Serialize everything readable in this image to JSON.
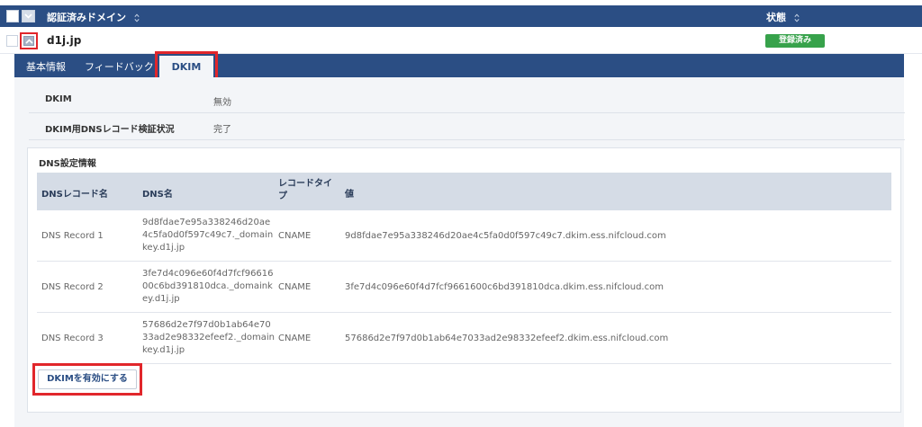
{
  "header": {
    "domain_column": "認証済みドメイン",
    "status_column": "状態"
  },
  "domain_row": {
    "domain": "d1j.jp",
    "status": "登録済み"
  },
  "tabs": [
    {
      "label": "基本情報",
      "active": false
    },
    {
      "label": "フィードバック",
      "active": false
    },
    {
      "label": "DKIM",
      "active": true
    }
  ],
  "dkim_info": [
    {
      "label": "DKIM",
      "value": "無効"
    },
    {
      "label": "DKIM用DNSレコード検証状況",
      "value": "完了"
    }
  ],
  "dns_settings": {
    "title": "DNS設定情報",
    "columns": [
      "DNSレコード名",
      "DNS名",
      "レコードタイプ",
      "値"
    ],
    "rows": [
      {
        "record_name": "DNS Record 1",
        "dns_name": "9d8fdae7e95a338246d20ae4c5fa0d0f597c49c7._domainkey.d1j.jp",
        "type": "CNAME",
        "value": "9d8fdae7e95a338246d20ae4c5fa0d0f597c49c7.dkim.ess.nifcloud.com"
      },
      {
        "record_name": "DNS Record 2",
        "dns_name": "3fe7d4c096e60f4d7fcf9661600c6bd391810dca._domainkey.d1j.jp",
        "type": "CNAME",
        "value": "3fe7d4c096e60f4d7fcf9661600c6bd391810dca.dkim.ess.nifcloud.com"
      },
      {
        "record_name": "DNS Record 3",
        "dns_name": "57686d2e7f97d0b1ab64e7033ad2e98332efeef2._domainkey.d1j.jp",
        "type": "CNAME",
        "value": "57686d2e7f97d0b1ab64e7033ad2e98332efeef2.dkim.ess.nifcloud.com"
      }
    ]
  },
  "actions": {
    "enable_dkim": "DKIMを有効にする"
  },
  "colors": {
    "header_bg": "#2b4e84",
    "status_green": "#37a24b",
    "highlight_red": "#e1262b",
    "panel_bg": "#f3f5f8"
  }
}
